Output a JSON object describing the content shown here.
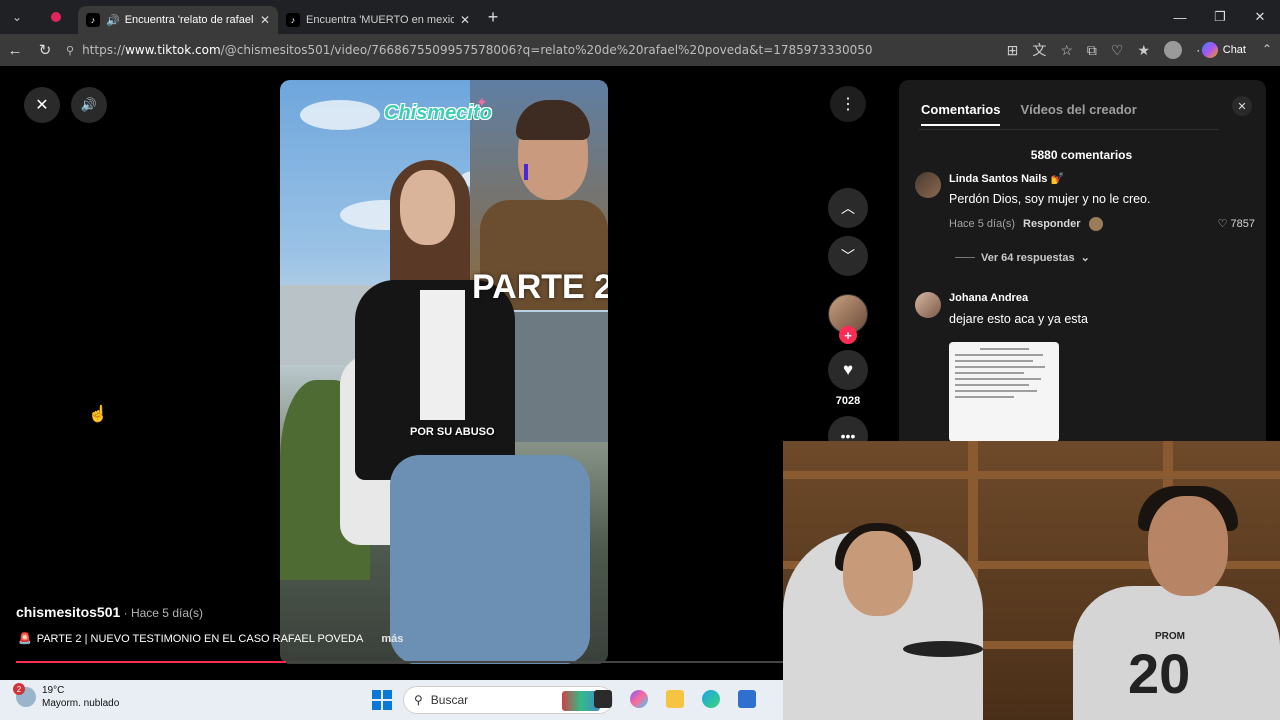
{
  "browser": {
    "tabs": [
      {
        "title": "Encuentra 'relato de rafael po",
        "active": true
      },
      {
        "title": "Encuentra 'MUERTO en mexico en",
        "active": false
      }
    ],
    "url_prefix": "https://",
    "url_host": "www.tiktok.com",
    "url_rest": "/@chismesitos501/video/7668675509957578006?q=relato%20de%20rafael%20poveda&t=1785973330050",
    "chat_label": "Chat"
  },
  "video": {
    "brand": "Chismecito",
    "overlay_title": "PARTE 2",
    "caption": "POR SU ABUSO",
    "author": "chismesitos501",
    "posted": " · Hace 5 día(s)",
    "description": "PARTE 2 | NUEVO TESTIMONIO EN EL CASO RAFAEL POVEDA",
    "more_label": "más",
    "likes": "7028",
    "progress": 0.35
  },
  "comments_panel": {
    "tabs": [
      "Comentarios",
      "Vídeos del creador"
    ],
    "count_title": "5880 comentarios",
    "comments": [
      {
        "name": "Linda Santos Nails 💅",
        "text": "Perdón Dios, soy mujer y no le creo.",
        "time": "Hace 5 día(s)",
        "reply_label": "Responder",
        "likes": "♡ 7857",
        "replies": "Ver 64 respuestas"
      },
      {
        "name": "Johana Andrea",
        "text": "dejare esto aca y ya esta"
      }
    ]
  },
  "webcam": {
    "shirt_text": "PROM",
    "shirt_number": "20"
  },
  "taskbar": {
    "weather_badge": "2",
    "temperature": "19°C",
    "condition": "Mayorm. nublado",
    "search_placeholder": "Buscar"
  },
  "colors": {
    "tiktok_red": "#fe2c55",
    "panel_bg": "#1a1a1a",
    "browser_bg": "#202124"
  }
}
